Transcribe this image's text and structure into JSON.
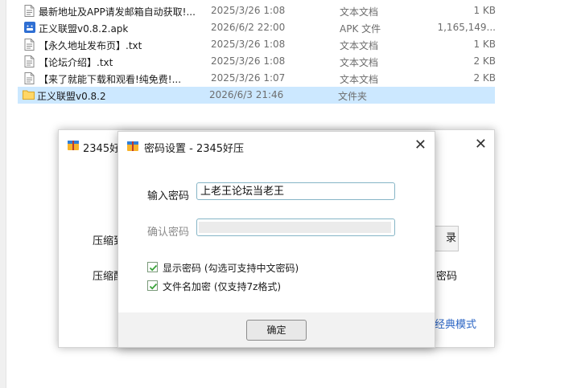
{
  "files": [
    {
      "name": "最新地址及APP请发邮箱自动获取!...",
      "date": "2025/3/26 1:08",
      "type": "文本文档",
      "size": "1 KB",
      "icon": "text-doc-icon"
    },
    {
      "name": "正义联盟v0.8.2.apk",
      "date": "2026/6/2 22:00",
      "type": "APK 文件",
      "size": "1,165,149...",
      "icon": "apk-icon"
    },
    {
      "name": "【永久地址发布页】.txt",
      "date": "2025/3/26 1:08",
      "type": "文本文档",
      "size": "1 KB",
      "icon": "text-doc-icon"
    },
    {
      "name": "【论坛介绍】.txt",
      "date": "2025/3/26 1:08",
      "type": "文本文档",
      "size": "2 KB",
      "icon": "text-doc-icon"
    },
    {
      "name": "【来了就能下载和观看!纯免费!...",
      "date": "2025/3/26 1:07",
      "type": "文本文档",
      "size": "2 KB",
      "icon": "text-doc-icon"
    },
    {
      "name": "正义联盟v0.8.2",
      "date": "2026/6/3 21:46",
      "type": "文件夹",
      "size": "",
      "icon": "folder-icon"
    }
  ],
  "back_dialog": {
    "title": "2345好",
    "label_1": "压缩到",
    "label_2": "压缩配",
    "button_partial": "录",
    "text_partial": "密码",
    "link_partial": "经典模式",
    "close": "✕"
  },
  "password_dialog": {
    "title": "密码设置 - 2345好压",
    "close": "✕",
    "enter_label": "输入密码",
    "enter_value": "上老王论坛当老王",
    "confirm_label": "确认密码",
    "confirm_value": "",
    "checkbox_1": {
      "label": "显示密码 (勾选可支持中文密码)",
      "checked": true
    },
    "checkbox_2": {
      "label": "文件名加密 (仅支持7z格式)",
      "checked": true
    },
    "ok_label": "确定"
  },
  "colors": {
    "selected_row": "#cce8ff",
    "link": "#2a64c4",
    "checkbox_check": "#3aa33a"
  }
}
